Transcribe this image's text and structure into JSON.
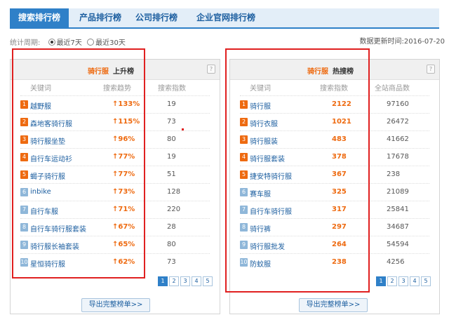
{
  "tabs": [
    "搜索排行榜",
    "产品排行榜",
    "公司排行榜",
    "企业官网排行榜"
  ],
  "period": {
    "label": "统计周期:",
    "option1": "最近7天",
    "option2": "最近30天"
  },
  "update": {
    "label": "数据更新时间:",
    "date": "2016-07-20"
  },
  "left": {
    "keyword": "骑行服",
    "title": "上升榜",
    "help": "?",
    "cols": [
      "关键词",
      "搜索趋势",
      "搜索指数"
    ],
    "rows": [
      {
        "rank": "1",
        "kw": "越野服",
        "trend": "133%",
        "idx": "19"
      },
      {
        "rank": "2",
        "kw": "森地客骑行服",
        "trend": "115%",
        "idx": "73"
      },
      {
        "rank": "3",
        "kw": "骑行服坐垫",
        "trend": "96%",
        "idx": "80"
      },
      {
        "rank": "4",
        "kw": "自行车运动衫",
        "trend": "77%",
        "idx": "19"
      },
      {
        "rank": "5",
        "kw": "蝎子骑行服",
        "trend": "77%",
        "idx": "51"
      },
      {
        "rank": "6",
        "kw": "inbike",
        "trend": "73%",
        "idx": "128"
      },
      {
        "rank": "7",
        "kw": "自行车服",
        "trend": "71%",
        "idx": "220"
      },
      {
        "rank": "8",
        "kw": "自行车骑行服套装",
        "trend": "67%",
        "idx": "28"
      },
      {
        "rank": "9",
        "kw": "骑行服长袖套装",
        "trend": "65%",
        "idx": "80"
      },
      {
        "rank": "10",
        "kw": "星恒骑行服",
        "trend": "62%",
        "idx": "73"
      }
    ],
    "pages": [
      "1",
      "2",
      "3",
      "4",
      "5"
    ],
    "export": "导出完整榜单>>"
  },
  "right": {
    "keyword": "骑行服",
    "title": "热搜榜",
    "help": "?",
    "cols": [
      "关键词",
      "搜索指数",
      "全站商品数"
    ],
    "rows": [
      {
        "rank": "1",
        "kw": "骑行服",
        "idx": "2122",
        "count": "97160"
      },
      {
        "rank": "2",
        "kw": "骑行衣服",
        "idx": "1021",
        "count": "26472"
      },
      {
        "rank": "3",
        "kw": "骑行服装",
        "idx": "483",
        "count": "41662"
      },
      {
        "rank": "4",
        "kw": "骑行服套装",
        "idx": "378",
        "count": "17678"
      },
      {
        "rank": "5",
        "kw": "捷安特骑行服",
        "idx": "367",
        "count": "238"
      },
      {
        "rank": "6",
        "kw": "赛车服",
        "idx": "325",
        "count": "21089"
      },
      {
        "rank": "7",
        "kw": "自行车骑行服",
        "idx": "317",
        "count": "25841"
      },
      {
        "rank": "8",
        "kw": "骑行裤",
        "idx": "297",
        "count": "34687"
      },
      {
        "rank": "9",
        "kw": "骑行服批发",
        "idx": "264",
        "count": "54594"
      },
      {
        "rank": "10",
        "kw": "防蚊服",
        "idx": "238",
        "count": "4256"
      }
    ],
    "pages": [
      "1",
      "2",
      "3",
      "4",
      "5"
    ],
    "export": "导出完整榜单>>"
  }
}
